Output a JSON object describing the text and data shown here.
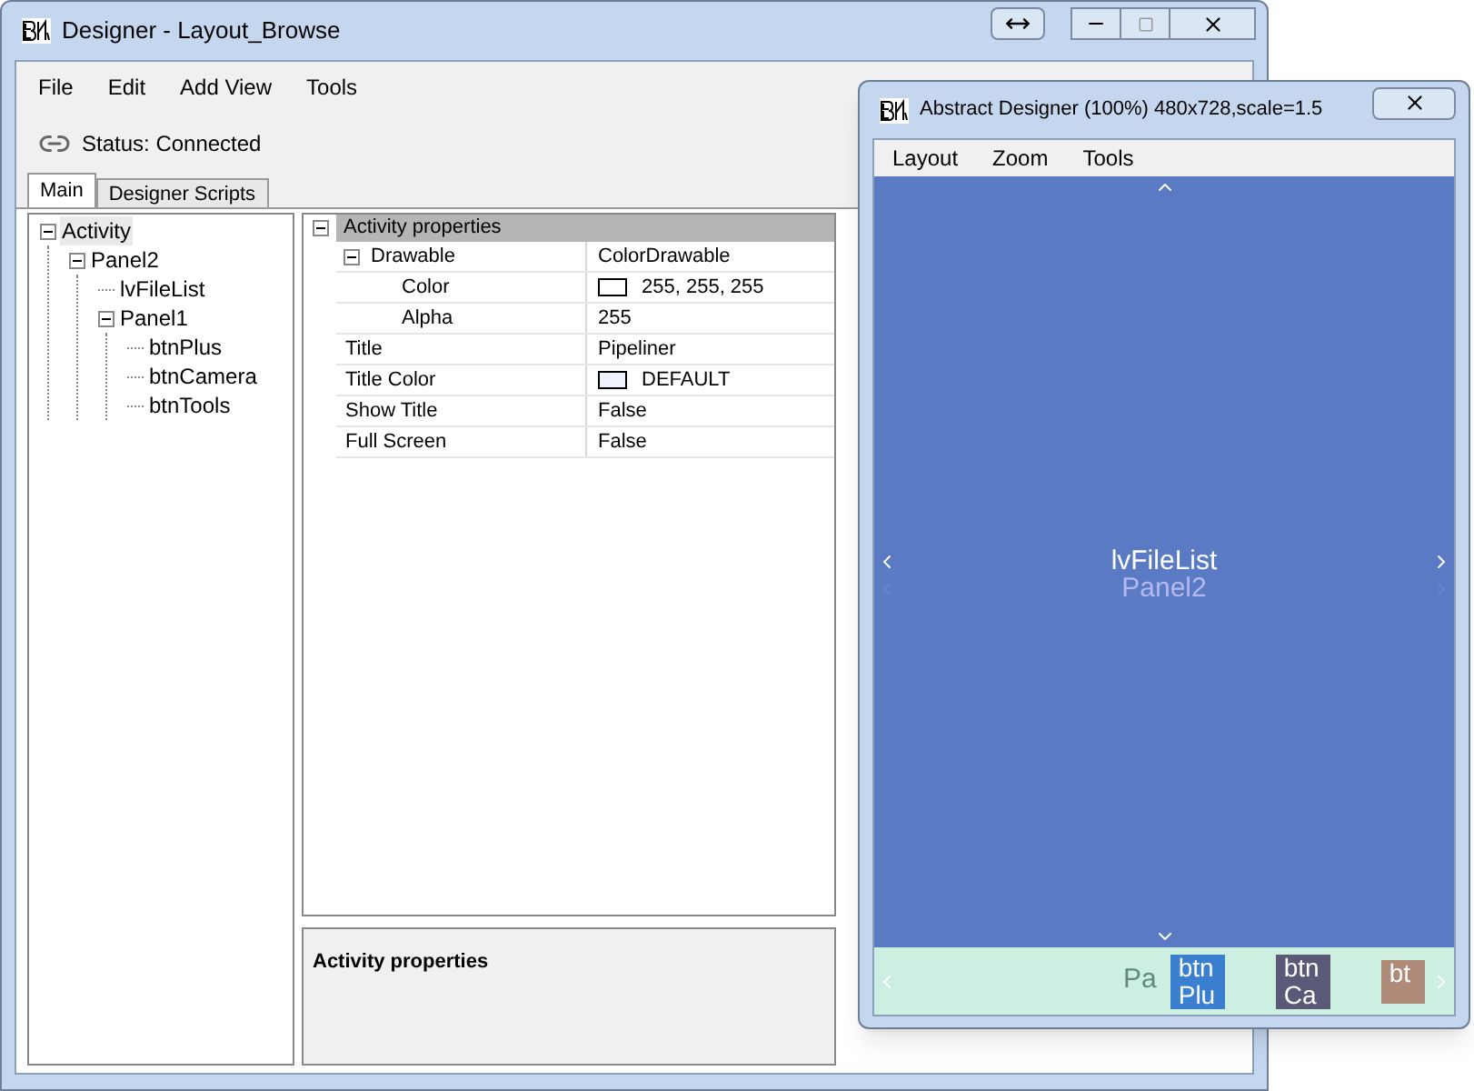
{
  "main_window": {
    "title": "Designer - Layout_Browse",
    "menu": [
      "File",
      "Edit",
      "Add View",
      "Tools"
    ],
    "status": "Status: Connected",
    "tabs": [
      {
        "label": "Main",
        "selected": true
      },
      {
        "label": "Designer Scripts",
        "selected": false
      }
    ],
    "tree": [
      {
        "label": "Activity",
        "expanded": true,
        "selected": true,
        "children": [
          {
            "label": "Panel2",
            "expanded": true,
            "selected": false,
            "children": [
              {
                "label": "lvFileList",
                "selected": false
              },
              {
                "label": "Panel1",
                "expanded": true,
                "selected": false,
                "children": [
                  {
                    "label": "btnPlus",
                    "selected": false
                  },
                  {
                    "label": "btnCamera",
                    "selected": false
                  },
                  {
                    "label": "btnTools",
                    "selected": false
                  }
                ]
              }
            ]
          }
        ]
      }
    ],
    "properties": {
      "category": "Activity properties",
      "rows": [
        {
          "name": "Drawable",
          "value": "ColorDrawable",
          "expanded": true,
          "children": [
            {
              "name": "Color",
              "value": "255, 255, 255",
              "color": "#ffffff"
            },
            {
              "name": "Alpha",
              "value": "255"
            }
          ]
        },
        {
          "name": "Title",
          "value": "Pipeliner"
        },
        {
          "name": "Title Color",
          "value": "DEFAULT",
          "color": "#eef3fb"
        },
        {
          "name": "Show Title",
          "value": "False"
        },
        {
          "name": "Full Screen",
          "value": "False"
        }
      ]
    },
    "description": "Activity properties"
  },
  "abstract_window": {
    "title": "Abstract Designer (100%) 480x728,scale=1.5",
    "menu": [
      "Layout",
      "Zoom",
      "Tools"
    ],
    "list_label": "lvFileList",
    "panel2_label": "Panel2",
    "panel1_label": "Pa",
    "buttons": [
      {
        "label": "btn Plu",
        "color": "#3a7fd0"
      },
      {
        "label": "btn Ca",
        "color": "#5a5a78"
      },
      {
        "label": "bt",
        "color": "#b08a78"
      }
    ]
  }
}
